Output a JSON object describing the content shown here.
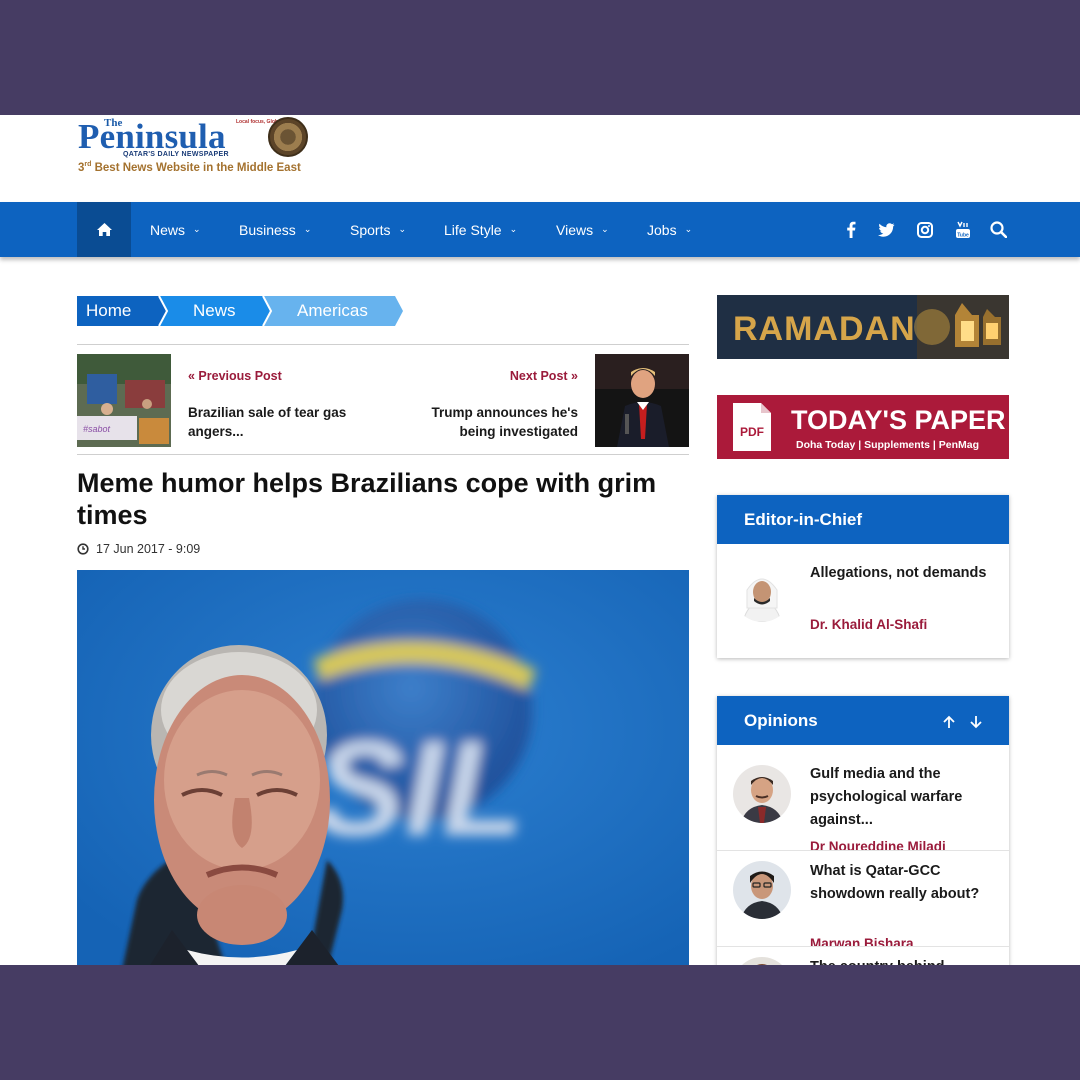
{
  "header": {
    "logo_the": "The",
    "logo_name": "Peninsula",
    "logo_tagline": "Local focus, Global vision",
    "logo_daily": "QATAR'S DAILY NEWSPAPER",
    "award_rank": "3",
    "award_ordinal": "rd",
    "award_text": " Best News Website in the Middle East"
  },
  "nav": {
    "items": [
      "News",
      "Business",
      "Sports",
      "Life Style",
      "Views",
      "Jobs"
    ],
    "icons": [
      "home-icon",
      "facebook-icon",
      "twitter-icon",
      "instagram-icon",
      "youtube-icon",
      "search-icon"
    ],
    "colors": {
      "bar": "#0d63c0",
      "home": "#0a4c93"
    }
  },
  "breadcrumb": [
    "Home",
    "News",
    "Americas"
  ],
  "post_nav": {
    "prev_label": "« Previous Post",
    "prev_title": "Brazilian sale of tear gas angers...",
    "next_label": "Next Post »",
    "next_title": "Trump announces he's being investigated"
  },
  "article": {
    "title": "Meme humor helps Brazilians cope with grim times",
    "date": "17 Jun 2017 - 9:09",
    "hero_text": "ASIL"
  },
  "sidebar": {
    "ramadan_text": "RAMADAN",
    "paper_title": "TODAY'S PAPER",
    "paper_icon": "PDF",
    "paper_links": "Doha Today  |  Supplements  |  PenMag",
    "editor": {
      "heading": "Editor-in-Chief",
      "title": "Allegations, not demands",
      "author": "Dr. Khalid Al-Shafi"
    },
    "opinions": {
      "heading": "Opinions",
      "items": [
        {
          "title": "Gulf media and the psychological warfare against...",
          "author": "Dr Noureddine Miladi"
        },
        {
          "title": "What is Qatar-GCC showdown really about?",
          "author": "Marwan Bishara"
        },
        {
          "title": "The country behind",
          "author": ""
        }
      ]
    }
  },
  "colors": {
    "accent_red": "#9a1b3b",
    "primary_blue": "#0d63c0",
    "page_frame": "#463c63"
  }
}
